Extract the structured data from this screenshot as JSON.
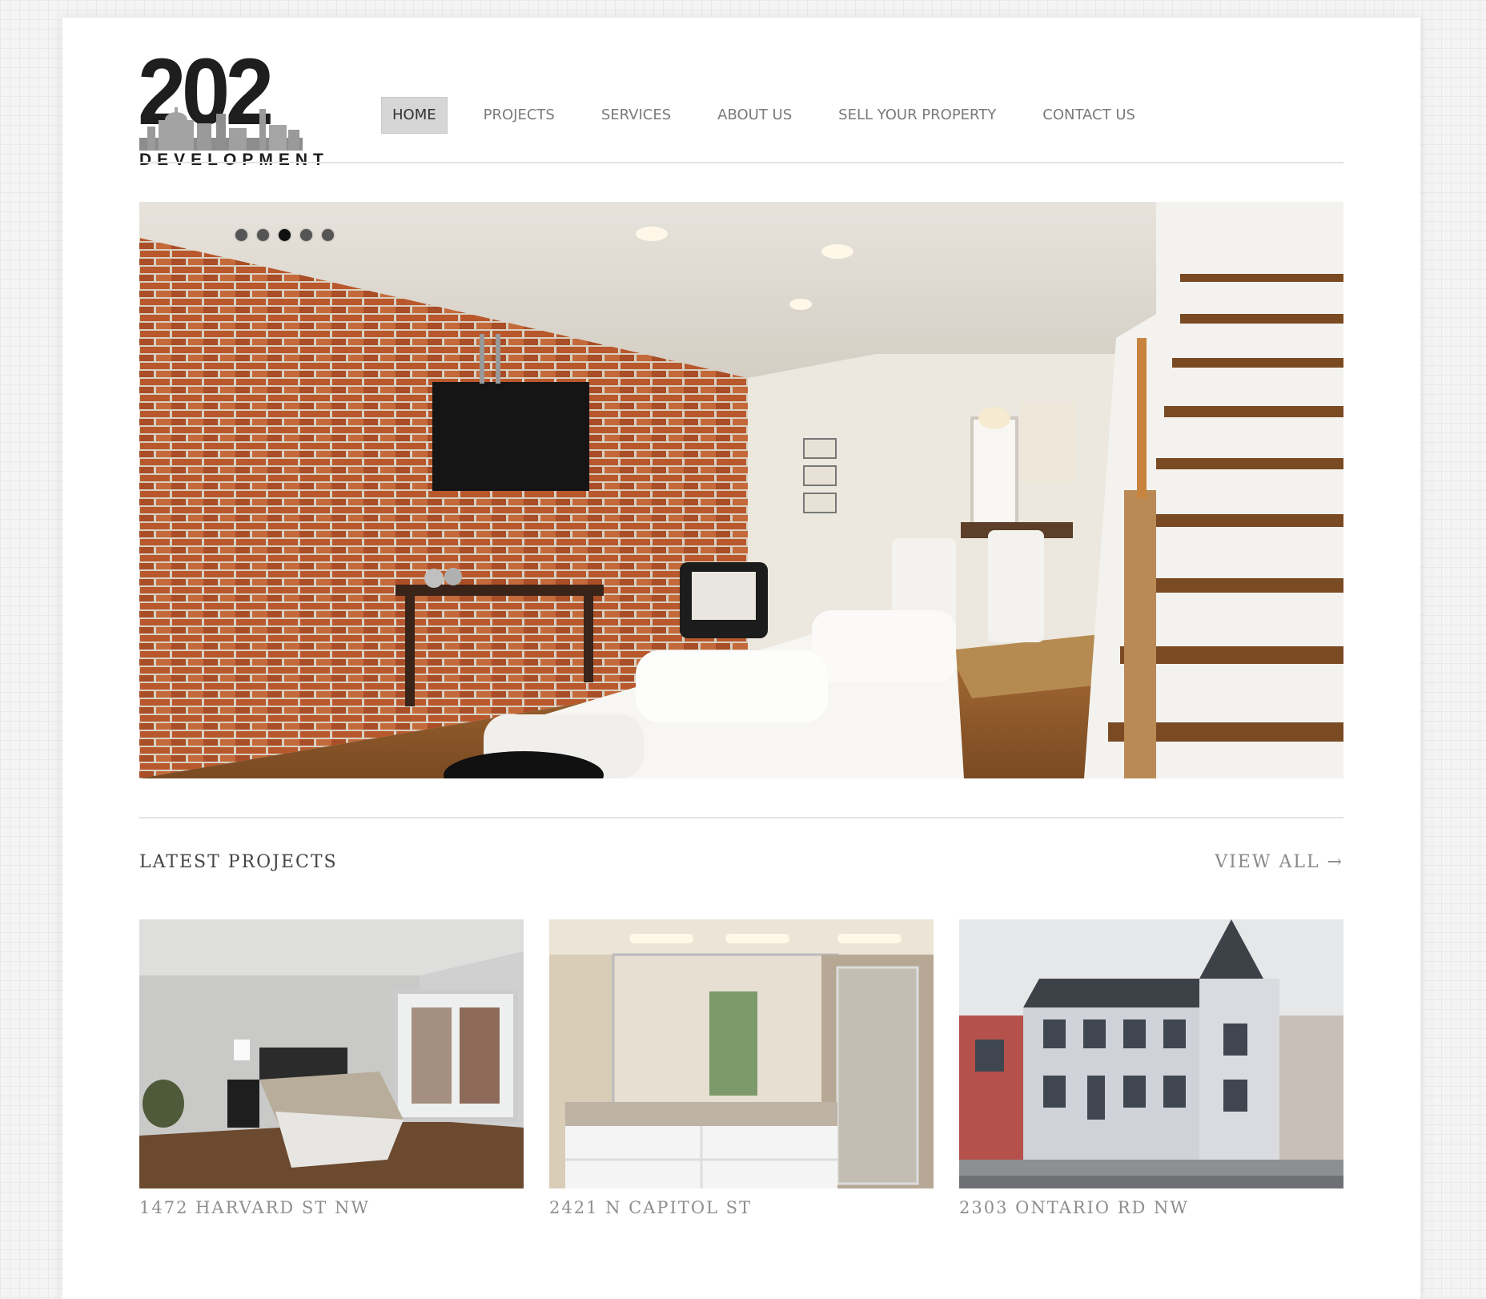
{
  "logo": {
    "number": "202",
    "subtitle": "DEVELOPMENT"
  },
  "nav": [
    {
      "label": "HOME",
      "active": true
    },
    {
      "label": "PROJECTS",
      "active": false
    },
    {
      "label": "SERVICES",
      "active": false
    },
    {
      "label": "ABOUT US",
      "active": false
    },
    {
      "label": "SELL YOUR PROPERTY",
      "active": false
    },
    {
      "label": "CONTACT US",
      "active": false
    }
  ],
  "slider": {
    "slide_count": 5,
    "active_slide": 3
  },
  "latest": {
    "title": "LATEST PROJECTS",
    "view_all": "VIEW ALL →",
    "projects": [
      {
        "caption": "1472 HARVARD ST NW"
      },
      {
        "caption": "2421 N CAPITOL ST"
      },
      {
        "caption": "2303 ONTARIO RD NW"
      }
    ]
  }
}
